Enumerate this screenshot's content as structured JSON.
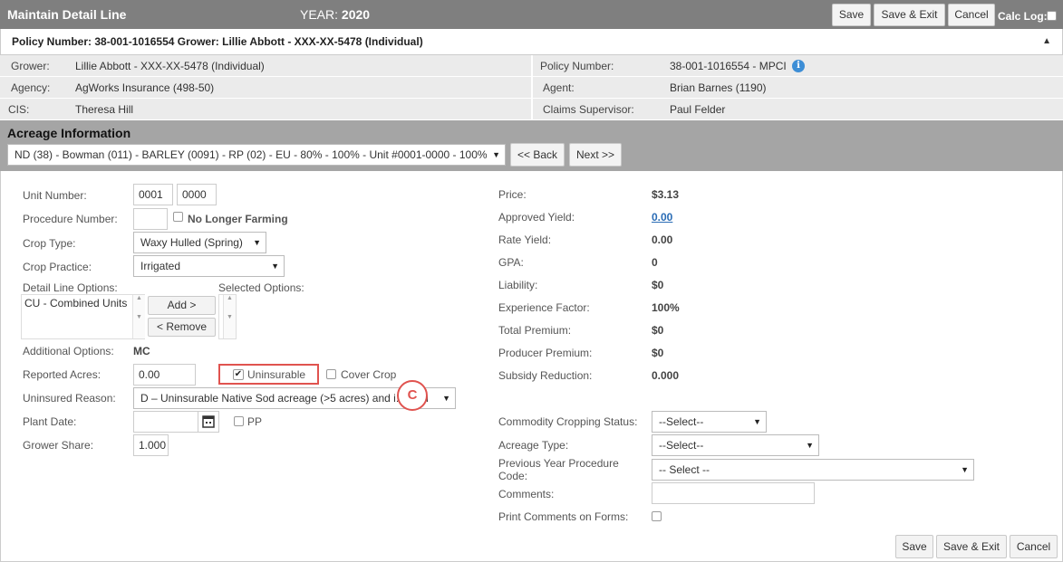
{
  "header": {
    "title": "Maintain Detail Line",
    "year_label": "YEAR:",
    "year_value": "2020",
    "save_label": "Save",
    "save_exit_label": "Save & Exit",
    "cancel_label": "Cancel",
    "calc_log_label": "Calc Log:"
  },
  "policy_bar": {
    "text": "Policy Number: 38-001-1016554 Grower: Lillie Abbott - XXX-XX-5478 (Individual)",
    "caret": "▲"
  },
  "info": {
    "grower_label": "Grower:",
    "grower_value": "Lillie Abbott - XXX-XX-5478 (Individual)",
    "policy_label": "Policy Number:",
    "policy_value": "38-001-1016554 - MPCI",
    "agency_label": "Agency:",
    "agency_value": "AgWorks Insurance (498-50)",
    "agent_label": "Agent:",
    "agent_value": "Brian Barnes (1190)",
    "cis_label": "CIS:",
    "cis_value": "Theresa Hill",
    "claims_label": "Claims Supervisor:",
    "claims_value": "Paul Felder"
  },
  "acreage": {
    "title": "Acreage Information",
    "unit_selected": "ND (38) - Bowman (011) - BARLEY (0091) - RP (02) - EU - 80% - 100% - Unit #0001-0000 - 100%",
    "back_label": "<< Back",
    "next_label": "Next >>"
  },
  "form": {
    "unit_number_label": "Unit Number:",
    "unit_number_1": "0001",
    "unit_number_2": "0000",
    "procedure_number_label": "Procedure Number:",
    "procedure_number_value": "",
    "no_longer_farming_label": "No Longer Farming",
    "crop_type_label": "Crop Type:",
    "crop_type_value": "Waxy Hulled (Spring)",
    "crop_practice_label": "Crop Practice:",
    "crop_practice_value": "Irrigated",
    "detail_options_label": "Detail Line Options:",
    "selected_options_label": "Selected Options:",
    "available_options": [
      "CU - Combined Units"
    ],
    "add_label": "Add >",
    "remove_label": "< Remove",
    "additional_options_label": "Additional Options:",
    "additional_options_value": "MC",
    "reported_acres_label": "Reported Acres:",
    "reported_acres_value": "0.00",
    "uninsurable_label": "Uninsurable",
    "uninsurable_checked": true,
    "cover_crop_label": "Cover Crop",
    "uninsured_reason_label": "Uninsured Reason:",
    "uninsured_reason_value": "D – Uninsurable Native Sod acreage (>5 acres) and i... Insu",
    "plant_date_label": "Plant Date:",
    "plant_date_value": "",
    "pp_label": "PP",
    "grower_share_label": "Grower Share:",
    "grower_share_value": "1.000",
    "callout_letter": "C"
  },
  "summary": {
    "price_label": "Price:",
    "price_value": "$3.13",
    "approved_yield_label": "Approved Yield:",
    "approved_yield_value": "0.00",
    "rate_yield_label": "Rate Yield:",
    "rate_yield_value": "0.00",
    "gpa_label": "GPA:",
    "gpa_value": "0",
    "liability_label": "Liability:",
    "liability_value": "$0",
    "experience_label": "Experience Factor:",
    "experience_value": "100%",
    "total_premium_label": "Total Premium:",
    "total_premium_value": "$0",
    "producer_premium_label": "Producer Premium:",
    "producer_premium_value": "$0",
    "subsidy_label": "Subsidy Reduction:",
    "subsidy_value": "0.000",
    "commodity_status_label": "Commodity Cropping Status:",
    "commodity_status_value": "--Select--",
    "acreage_type_label": "Acreage Type:",
    "acreage_type_value": "--Select--",
    "prev_proc_label_1": "Previous Year Procedure",
    "prev_proc_label_2": "Code:",
    "prev_proc_value": "-- Select --",
    "comments_label": "Comments:",
    "comments_value": "",
    "print_comments_label": "Print Comments on Forms:"
  },
  "footer": {
    "save_label": "Save",
    "save_exit_label": "Save & Exit",
    "cancel_label": "Cancel"
  }
}
